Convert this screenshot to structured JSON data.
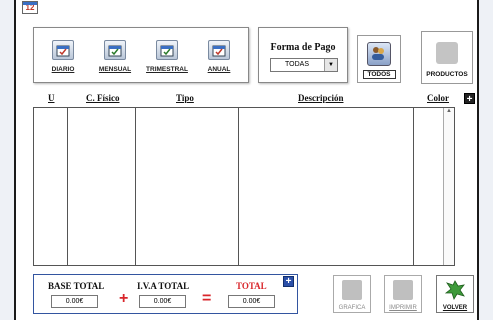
{
  "window": {
    "calendar_icon_text": "12"
  },
  "period_buttons": [
    {
      "label": "DIARIO",
      "icon": "calendar-diario-icon"
    },
    {
      "label": "MENSUAL",
      "icon": "calendar-mensual-icon"
    },
    {
      "label": "TRIMESTRAL",
      "icon": "calendar-trimestral-icon"
    },
    {
      "label": "ANUAL",
      "icon": "calendar-anual-icon"
    }
  ],
  "payment": {
    "title": "Forma de Pago",
    "selected": "TODAS"
  },
  "filters": {
    "todos_label": "TODOS",
    "productos_label": "PRODUCTOS"
  },
  "table": {
    "columns": [
      "U",
      "C. Físico",
      "Tipo",
      "Descripción",
      "Color"
    ],
    "add_symbol": "+"
  },
  "totals": {
    "base_label": "BASE TOTAL",
    "base_value": "0.00€",
    "iva_label": "I.V.A TOTAL",
    "iva_value": "0.00€",
    "total_label": "TOTAL",
    "total_value": "0.00€",
    "plus_op": "+",
    "equals_op": "=",
    "add_symbol": "+"
  },
  "footer_buttons": {
    "grafica": "GRAFICA",
    "imprimir": "IMPRIMIR",
    "volver": "VOLVER"
  },
  "colors": {
    "total_label": "#d9262b",
    "accent_blue": "#2b4fa8",
    "volver_icon": "#3e9a3a"
  }
}
